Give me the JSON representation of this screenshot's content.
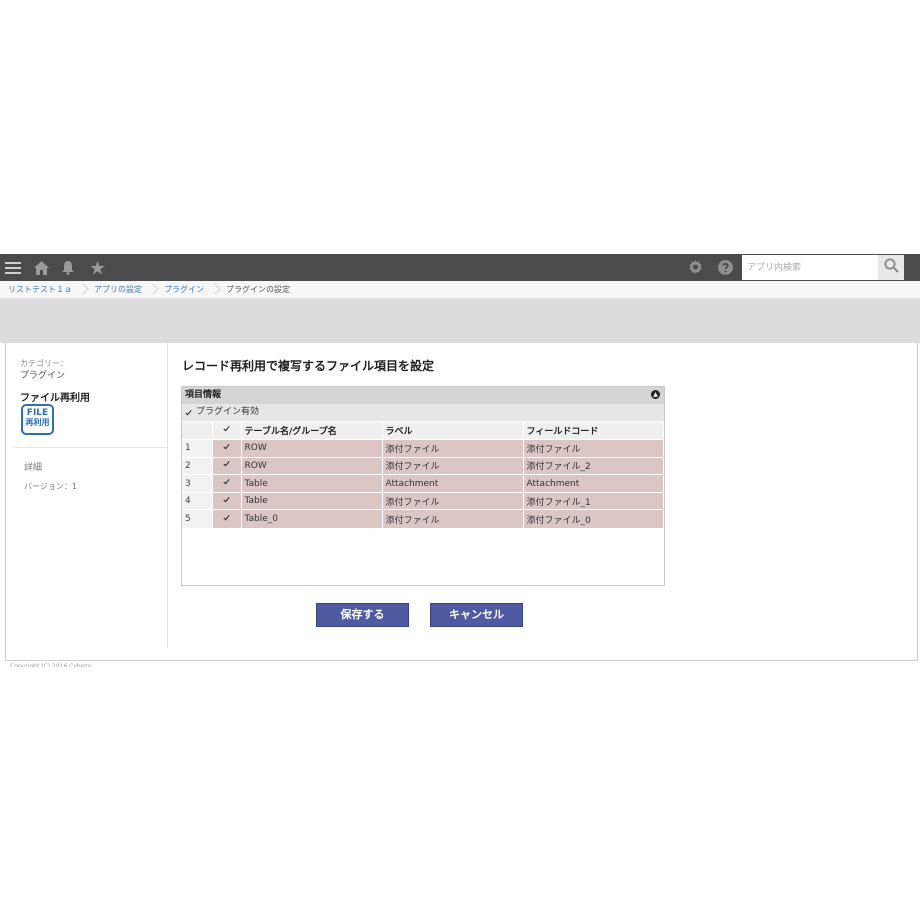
{
  "header": {
    "search_placeholder": "アプリ内検索",
    "icons": [
      "menu-icon",
      "home-icon",
      "bell-icon",
      "star-icon",
      "gear-icon",
      "help-icon",
      "search-icon"
    ]
  },
  "breadcrumb": [
    "リストテスト１ａ",
    "アプリの設定",
    "プラグイン",
    "プラグインの設定"
  ],
  "sidebar": {
    "category_label": "カテゴリー：",
    "category_value": "プラグイン",
    "plugin_name": "ファイル再利用",
    "logo_line1": "FILE",
    "logo_line2": "再利用",
    "detail_link": "詳細",
    "version": "バージョン：1"
  },
  "main": {
    "title": "レコード再利用で複写するファイル項目を設定",
    "section_title": "項目情報",
    "enable_label": "プラグイン有効",
    "columns": [
      "テーブル名/グループ名",
      "ラベル",
      "フィールドコード"
    ],
    "rows": [
      {
        "num": "1",
        "group": "ROW",
        "label": "添付ファイル",
        "code": "添付ファイル",
        "checked": true
      },
      {
        "num": "2",
        "group": "ROW",
        "label": "添付ファイル",
        "code": "添付ファイル_2",
        "checked": true
      },
      {
        "num": "3",
        "group": "Table",
        "label": "Attachment",
        "code": "Attachment",
        "checked": true
      },
      {
        "num": "4",
        "group": "Table",
        "label": "添付ファイル",
        "code": "添付ファイル_1",
        "checked": true
      },
      {
        "num": "5",
        "group": "Table_0",
        "label": "添付ファイル",
        "code": "添付ファイル_0",
        "checked": true
      }
    ],
    "save_label": "保存する",
    "cancel_label": "キャンセル"
  },
  "footer": {
    "copyright": "Copyright (C) 2016 Cybozu"
  },
  "colors": {
    "header_bg": "#4b4b4b",
    "row_bg": "#dcc6c4",
    "button_bg": "#4e5aa2",
    "link": "#3a78b5"
  }
}
